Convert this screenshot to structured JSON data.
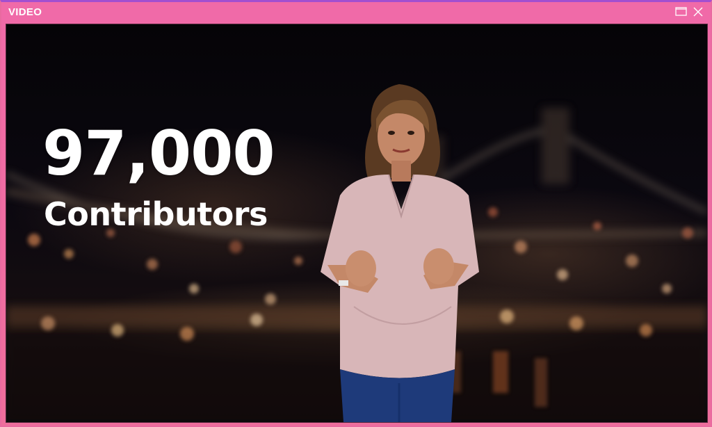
{
  "window": {
    "title": "VIDEO",
    "maximize_icon": "maximize-icon",
    "close_icon": "close-icon",
    "frame_color": "#ef6ca2",
    "accent_top": "#a24fd0"
  },
  "video": {
    "headline_number": "97,000",
    "headline_text": "Contributors",
    "scene": "presenter standing in front of blurred night city skyline with bridge"
  }
}
